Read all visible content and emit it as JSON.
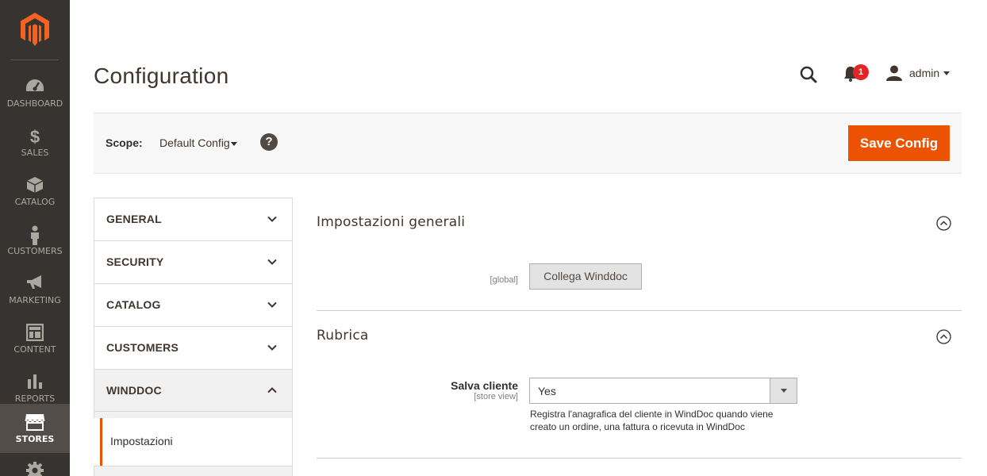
{
  "nav": {
    "items": [
      {
        "label": "DASHBOARD",
        "icon": "dashboard-icon"
      },
      {
        "label": "SALES",
        "icon": "dollar-icon"
      },
      {
        "label": "CATALOG",
        "icon": "box-icon"
      },
      {
        "label": "CUSTOMERS",
        "icon": "person-icon"
      },
      {
        "label": "MARKETING",
        "icon": "megaphone-icon"
      },
      {
        "label": "CONTENT",
        "icon": "layout-icon"
      },
      {
        "label": "REPORTS",
        "icon": "bar-chart-icon"
      },
      {
        "label": "STORES",
        "icon": "store-icon"
      }
    ]
  },
  "header": {
    "title": "Configuration",
    "notifications_count": "1",
    "user_name": "admin"
  },
  "scope": {
    "label": "Scope:",
    "value": "Default Config",
    "help": "?",
    "save_label": "Save Config"
  },
  "tabs": [
    {
      "label": "GENERAL"
    },
    {
      "label": "SECURITY"
    },
    {
      "label": "CATALOG"
    },
    {
      "label": "CUSTOMERS"
    },
    {
      "label": "WINDDOC"
    }
  ],
  "subtab": {
    "label": "Impostazioni"
  },
  "sections": {
    "general": {
      "title": "Impostazioni generali",
      "scope_hint": "[global]",
      "button_label": "Collega Winddoc"
    },
    "rubrica": {
      "title": "Rubrica",
      "field_label": "Salva cliente",
      "scope_hint": "[store view]",
      "select_value": "Yes",
      "note": "Registra l'anagrafica del cliente in WindDoc quando viene creato un ordine, una fattura o ricevuta in WindDoc"
    }
  },
  "colors": {
    "nav_bg": "#373330",
    "accent": "#eb5202",
    "badge": "#e22626"
  }
}
